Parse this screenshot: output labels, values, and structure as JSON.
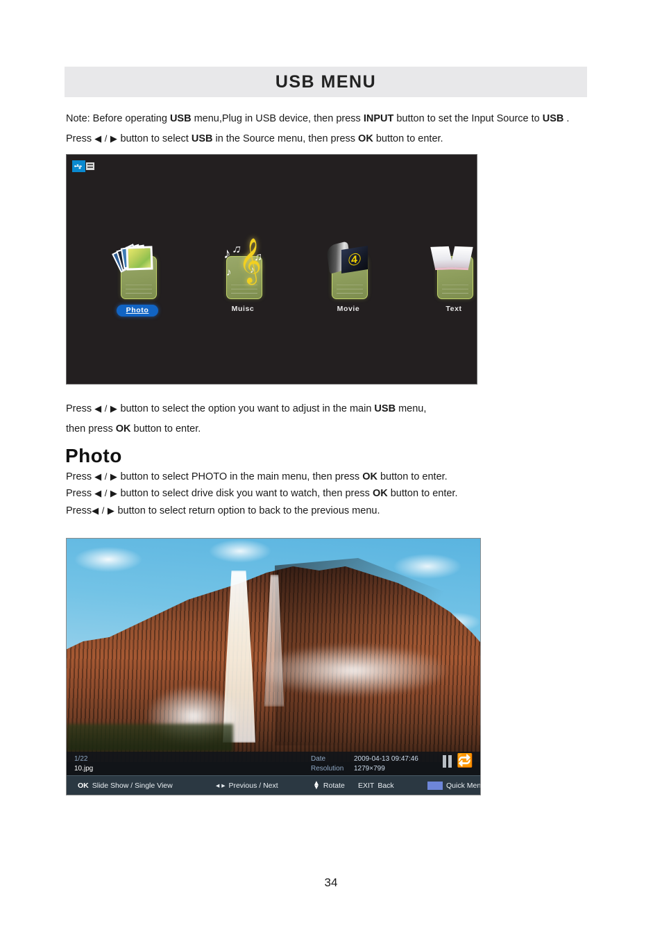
{
  "document": {
    "title": "USB MENU",
    "page_number": "34"
  },
  "intro": {
    "note_prefix": "Note: Before operating ",
    "note_b1": "USB",
    "note_mid1": " menu,Plug in USB device, then press ",
    "note_b2": "INPUT",
    "note_mid2": " button to set the Input Source to ",
    "note_b3": "USB",
    "note_suffix": " .",
    "press_prefix": "Press ",
    "press_arrows": "◀ / ▶",
    "press_mid1": " button to select ",
    "press_b1": "USB",
    "press_mid2": " in the Source menu,  then press ",
    "press_b2": "OK",
    "press_suffix": " button to enter."
  },
  "usb_screen": {
    "badge_icon": "usb-plug-icon",
    "tiles": [
      {
        "label": "Photo",
        "icon": "photo-stack-icon",
        "selected": true
      },
      {
        "label": "Muisc",
        "icon": "music-note-icon",
        "selected": false
      },
      {
        "label": "Movie",
        "icon": "film-reel-icon",
        "selected": false
      },
      {
        "label": "Text",
        "icon": "open-book-icon",
        "selected": false
      }
    ]
  },
  "after_screen": {
    "line1_prefix": "Press ",
    "line1_arrows": "◀ / ▶",
    "line1_mid": " button to select the option you want to adjust in the main ",
    "line1_b": "USB",
    "line1_suffix": " menu,",
    "line2_prefix": "then press ",
    "line2_b": "OK",
    "line2_suffix": " button to enter."
  },
  "photo_section": {
    "heading": "Photo",
    "lines": [
      {
        "prefix": "Press ",
        "arrows": "◀ / ▶",
        "mid": " button to select PHOTO in the main menu,  then press ",
        "bold": "OK",
        "suffix": " button to enter."
      },
      {
        "prefix": "Press ",
        "arrows": "◀ / ▶",
        "mid": " button to select drive disk you want to watch, then press ",
        "bold": "OK",
        "suffix": " button to enter."
      },
      {
        "prefix": "Press",
        "arrows": "◀ / ▶",
        "mid": " button to select return option to back to the previous menu.",
        "bold": "",
        "suffix": ""
      }
    ]
  },
  "photo_viewer": {
    "index": "1/22",
    "filename": "10.jpg",
    "date_label": "Date",
    "date_value": "2009-04-13  09:47:46",
    "resolution_label": "Resolution",
    "resolution_value": "1279×799",
    "pause_icon": "pause-icon",
    "repeat_icon": "repeat-icon",
    "actions": {
      "ok_key": "OK",
      "ok_label": "Slide Show / Single View",
      "prev_arrows": "◂ ▸",
      "prev_label": "Previous / Next",
      "rotate_label": "Rotate",
      "exit_key": "EXIT",
      "exit_label": "Back",
      "quick_label": "Quick Menu"
    }
  },
  "colors": {
    "title_bar_bg": "#e8e8ea",
    "usb_screen_bg": "#231f20",
    "selected_chip": "#1164c4",
    "osd_bar_bg": "#2b3842",
    "repeat_green": "#22c03c",
    "quick_menu_chip": "#6e86d8"
  }
}
